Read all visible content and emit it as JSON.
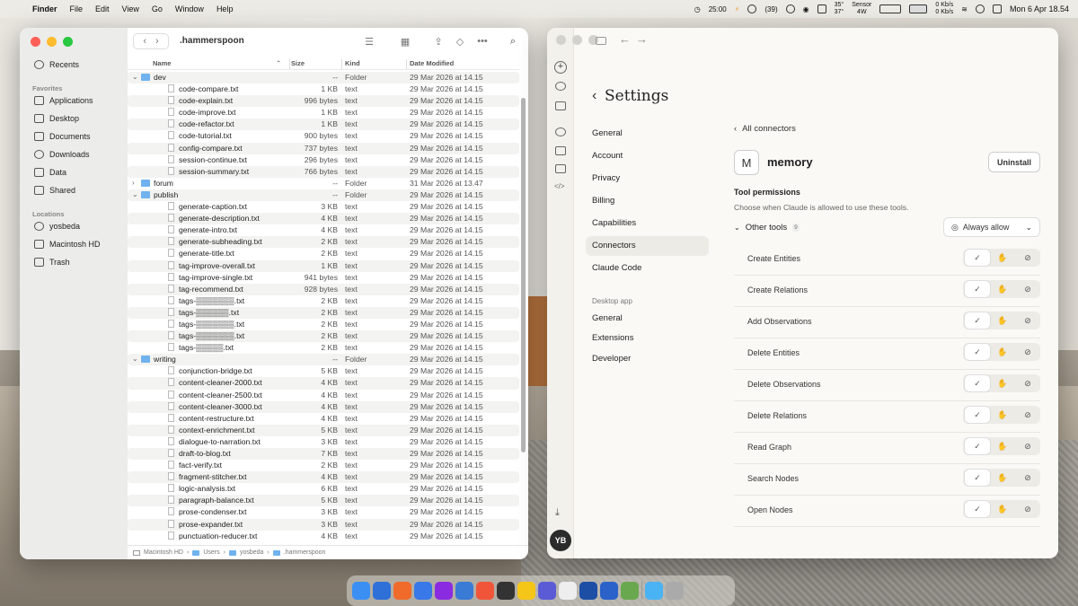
{
  "menubar": {
    "app_name": "Finder",
    "items": [
      "File",
      "Edit",
      "View",
      "Go",
      "Window",
      "Help"
    ],
    "timer": "25:00",
    "badge_count": "(39)",
    "temps": [
      "35°",
      "37°"
    ],
    "sensor_label": "Sensor",
    "power": "4W",
    "network_up": "0 Kb/s",
    "network_down": "0 Kb/s",
    "datetime": "Mon 6 Apr  18.54"
  },
  "finder": {
    "title": ".hammerspoon",
    "sidebar": {
      "recents": "Recents",
      "favorites_header": "Favorites",
      "favorites": [
        "Applications",
        "Desktop",
        "Documents",
        "Downloads",
        "Data",
        "Shared"
      ],
      "locations_header": "Locations",
      "locations": [
        "yosbeda",
        "Macintosh HD",
        "Trash"
      ]
    },
    "columns": {
      "name": "Name",
      "size": "Size",
      "kind": "Kind",
      "date": "Date Modified"
    },
    "rows": [
      {
        "name": "dev",
        "size": "--",
        "kind": "Folder",
        "date": "29 Mar 2026 at 14.15",
        "type": "folder-open",
        "level": 0
      },
      {
        "name": "code-compare.txt",
        "size": "1 KB",
        "kind": "text",
        "date": "29 Mar 2026 at 14.15",
        "type": "file",
        "level": 1
      },
      {
        "name": "code-explain.txt",
        "size": "996 bytes",
        "kind": "text",
        "date": "29 Mar 2026 at 14.15",
        "type": "file",
        "level": 1
      },
      {
        "name": "code-improve.txt",
        "size": "1 KB",
        "kind": "text",
        "date": "29 Mar 2026 at 14.15",
        "type": "file",
        "level": 1
      },
      {
        "name": "code-refactor.txt",
        "size": "1 KB",
        "kind": "text",
        "date": "29 Mar 2026 at 14.15",
        "type": "file",
        "level": 1
      },
      {
        "name": "code-tutorial.txt",
        "size": "900 bytes",
        "kind": "text",
        "date": "29 Mar 2026 at 14.15",
        "type": "file",
        "level": 1
      },
      {
        "name": "config-compare.txt",
        "size": "737 bytes",
        "kind": "text",
        "date": "29 Mar 2026 at 14.15",
        "type": "file",
        "level": 1
      },
      {
        "name": "session-continue.txt",
        "size": "296 bytes",
        "kind": "text",
        "date": "29 Mar 2026 at 14.15",
        "type": "file",
        "level": 1
      },
      {
        "name": "session-summary.txt",
        "size": "766 bytes",
        "kind": "text",
        "date": "29 Mar 2026 at 14.15",
        "type": "file",
        "level": 1
      },
      {
        "name": "forum",
        "size": "--",
        "kind": "Folder",
        "date": "31 Mar 2026 at 13.47",
        "type": "folder-closed",
        "level": 0
      },
      {
        "name": "publish",
        "size": "--",
        "kind": "Folder",
        "date": "29 Mar 2026 at 14.15",
        "type": "folder-open",
        "level": 0
      },
      {
        "name": "generate-caption.txt",
        "size": "3 KB",
        "kind": "text",
        "date": "29 Mar 2026 at 14.15",
        "type": "file",
        "level": 1
      },
      {
        "name": "generate-description.txt",
        "size": "4 KB",
        "kind": "text",
        "date": "29 Mar 2026 at 14.15",
        "type": "file",
        "level": 1
      },
      {
        "name": "generate-intro.txt",
        "size": "4 KB",
        "kind": "text",
        "date": "29 Mar 2026 at 14.15",
        "type": "file",
        "level": 1
      },
      {
        "name": "generate-subheading.txt",
        "size": "2 KB",
        "kind": "text",
        "date": "29 Mar 2026 at 14.15",
        "type": "file",
        "level": 1
      },
      {
        "name": "generate-title.txt",
        "size": "2 KB",
        "kind": "text",
        "date": "29 Mar 2026 at 14.15",
        "type": "file",
        "level": 1
      },
      {
        "name": "tag-improve-overall.txt",
        "size": "1 KB",
        "kind": "text",
        "date": "29 Mar 2026 at 14.15",
        "type": "file",
        "level": 1
      },
      {
        "name": "tag-improve-single.txt",
        "size": "941 bytes",
        "kind": "text",
        "date": "29 Mar 2026 at 14.15",
        "type": "file",
        "level": 1
      },
      {
        "name": "tag-recommend.txt",
        "size": "928 bytes",
        "kind": "text",
        "date": "29 Mar 2026 at 14.15",
        "type": "file",
        "level": 1
      },
      {
        "name": "tags-▒▒▒▒▒▒▒.txt",
        "size": "2 KB",
        "kind": "text",
        "date": "29 Mar 2026 at 14.15",
        "type": "file",
        "level": 1
      },
      {
        "name": "tags-▒▒▒▒▒▒.txt",
        "size": "2 KB",
        "kind": "text",
        "date": "29 Mar 2026 at 14.15",
        "type": "file",
        "level": 1
      },
      {
        "name": "tags-▒▒▒▒▒▒▒.txt",
        "size": "2 KB",
        "kind": "text",
        "date": "29 Mar 2026 at 14.15",
        "type": "file",
        "level": 1
      },
      {
        "name": "tags-▒▒▒▒▒▒▒.txt",
        "size": "2 KB",
        "kind": "text",
        "date": "29 Mar 2026 at 14.15",
        "type": "file",
        "level": 1
      },
      {
        "name": "tags-▒▒▒▒▒.txt",
        "size": "2 KB",
        "kind": "text",
        "date": "29 Mar 2026 at 14.15",
        "type": "file",
        "level": 1
      },
      {
        "name": "writing",
        "size": "--",
        "kind": "Folder",
        "date": "29 Mar 2026 at 14.15",
        "type": "folder-open",
        "level": 0
      },
      {
        "name": "conjunction-bridge.txt",
        "size": "5 KB",
        "kind": "text",
        "date": "29 Mar 2026 at 14.15",
        "type": "file",
        "level": 1
      },
      {
        "name": "content-cleaner-2000.txt",
        "size": "4 KB",
        "kind": "text",
        "date": "29 Mar 2026 at 14.15",
        "type": "file",
        "level": 1
      },
      {
        "name": "content-cleaner-2500.txt",
        "size": "4 KB",
        "kind": "text",
        "date": "29 Mar 2026 at 14.15",
        "type": "file",
        "level": 1
      },
      {
        "name": "content-cleaner-3000.txt",
        "size": "4 KB",
        "kind": "text",
        "date": "29 Mar 2026 at 14.15",
        "type": "file",
        "level": 1
      },
      {
        "name": "content-restructure.txt",
        "size": "4 KB",
        "kind": "text",
        "date": "29 Mar 2026 at 14.15",
        "type": "file",
        "level": 1
      },
      {
        "name": "context-enrichment.txt",
        "size": "5 KB",
        "kind": "text",
        "date": "29 Mar 2026 at 14.15",
        "type": "file",
        "level": 1
      },
      {
        "name": "dialogue-to-narration.txt",
        "size": "3 KB",
        "kind": "text",
        "date": "29 Mar 2026 at 14.15",
        "type": "file",
        "level": 1
      },
      {
        "name": "draft-to-blog.txt",
        "size": "7 KB",
        "kind": "text",
        "date": "29 Mar 2026 at 14.15",
        "type": "file",
        "level": 1
      },
      {
        "name": "fact-verify.txt",
        "size": "2 KB",
        "kind": "text",
        "date": "29 Mar 2026 at 14.15",
        "type": "file",
        "level": 1
      },
      {
        "name": "fragment-stitcher.txt",
        "size": "4 KB",
        "kind": "text",
        "date": "29 Mar 2026 at 14.15",
        "type": "file",
        "level": 1
      },
      {
        "name": "logic-analysis.txt",
        "size": "6 KB",
        "kind": "text",
        "date": "29 Mar 2026 at 14.15",
        "type": "file",
        "level": 1
      },
      {
        "name": "paragraph-balance.txt",
        "size": "5 KB",
        "kind": "text",
        "date": "29 Mar 2026 at 14.15",
        "type": "file",
        "level": 1
      },
      {
        "name": "prose-condenser.txt",
        "size": "3 KB",
        "kind": "text",
        "date": "29 Mar 2026 at 14.15",
        "type": "file",
        "level": 1
      },
      {
        "name": "prose-expander.txt",
        "size": "3 KB",
        "kind": "text",
        "date": "29 Mar 2026 at 14.15",
        "type": "file",
        "level": 1
      },
      {
        "name": "punctuation-reducer.txt",
        "size": "4 KB",
        "kind": "text",
        "date": "29 Mar 2026 at 14.15",
        "type": "file",
        "level": 1
      }
    ],
    "pathbar": [
      "Macintosh HD",
      "Users",
      "yosbeda",
      ".hammerspoon"
    ]
  },
  "claude": {
    "settings_title": "Settings",
    "nav": [
      "General",
      "Account",
      "Privacy",
      "Billing",
      "Capabilities",
      "Connectors",
      "Claude Code"
    ],
    "active_nav": "Connectors",
    "desktop_section": "Desktop app",
    "desktop_nav": [
      "General",
      "Extensions",
      "Developer"
    ],
    "back_link": "All connectors",
    "connector_initial": "M",
    "connector_name": "memory",
    "uninstall_label": "Uninstall",
    "perm_title": "Tool permissions",
    "perm_desc": "Choose when Claude is allowed to use these tools.",
    "other_tools_label": "Other tools",
    "other_tools_count": "9",
    "always_allow_label": "Always allow",
    "tools": [
      "Create Entities",
      "Create Relations",
      "Add Observations",
      "Delete Entities",
      "Delete Observations",
      "Delete Relations",
      "Read Graph",
      "Search Nodes",
      "Open Nodes"
    ],
    "avatar_initials": "YB"
  },
  "colors": {
    "folder": "#6fb2ee",
    "active_nav_bg": "#ecebe5",
    "close": "#ff5f57",
    "minimize": "#febc2e",
    "zoom": "#28c840"
  }
}
